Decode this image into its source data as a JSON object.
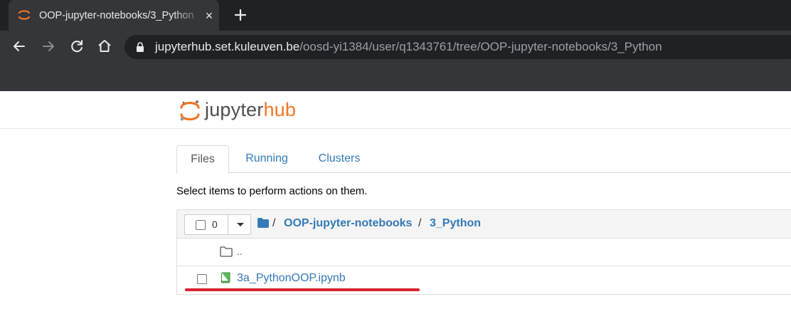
{
  "browser": {
    "tab": {
      "title": "OOP-jupyter-notebooks/3_Python",
      "close": "×",
      "new_tab": "+"
    },
    "url": {
      "host": "jupyterhub.set.kuleuven.be",
      "path": "/oosd-yi1384/user/q1343761/tree/OOP-jupyter-notebooks/3_Python"
    }
  },
  "jupyter": {
    "logo": {
      "part1": "jupyter",
      "part2": "hub",
      "brand_color": "#f37726"
    },
    "tabs": [
      "Files",
      "Running",
      "Clusters"
    ],
    "hint": "Select items to perform actions on them.",
    "selection": {
      "count": "0"
    },
    "breadcrumb": {
      "sep": "/",
      "items": [
        "OOP-jupyter-notebooks",
        "3_Python"
      ]
    },
    "rows": [
      {
        "name": "..",
        "icon": "folder-icon"
      },
      {
        "name": "3a_PythonOOP.ipynb",
        "icon": "notebook-icon"
      }
    ],
    "annotation_color": "#d9232d"
  }
}
